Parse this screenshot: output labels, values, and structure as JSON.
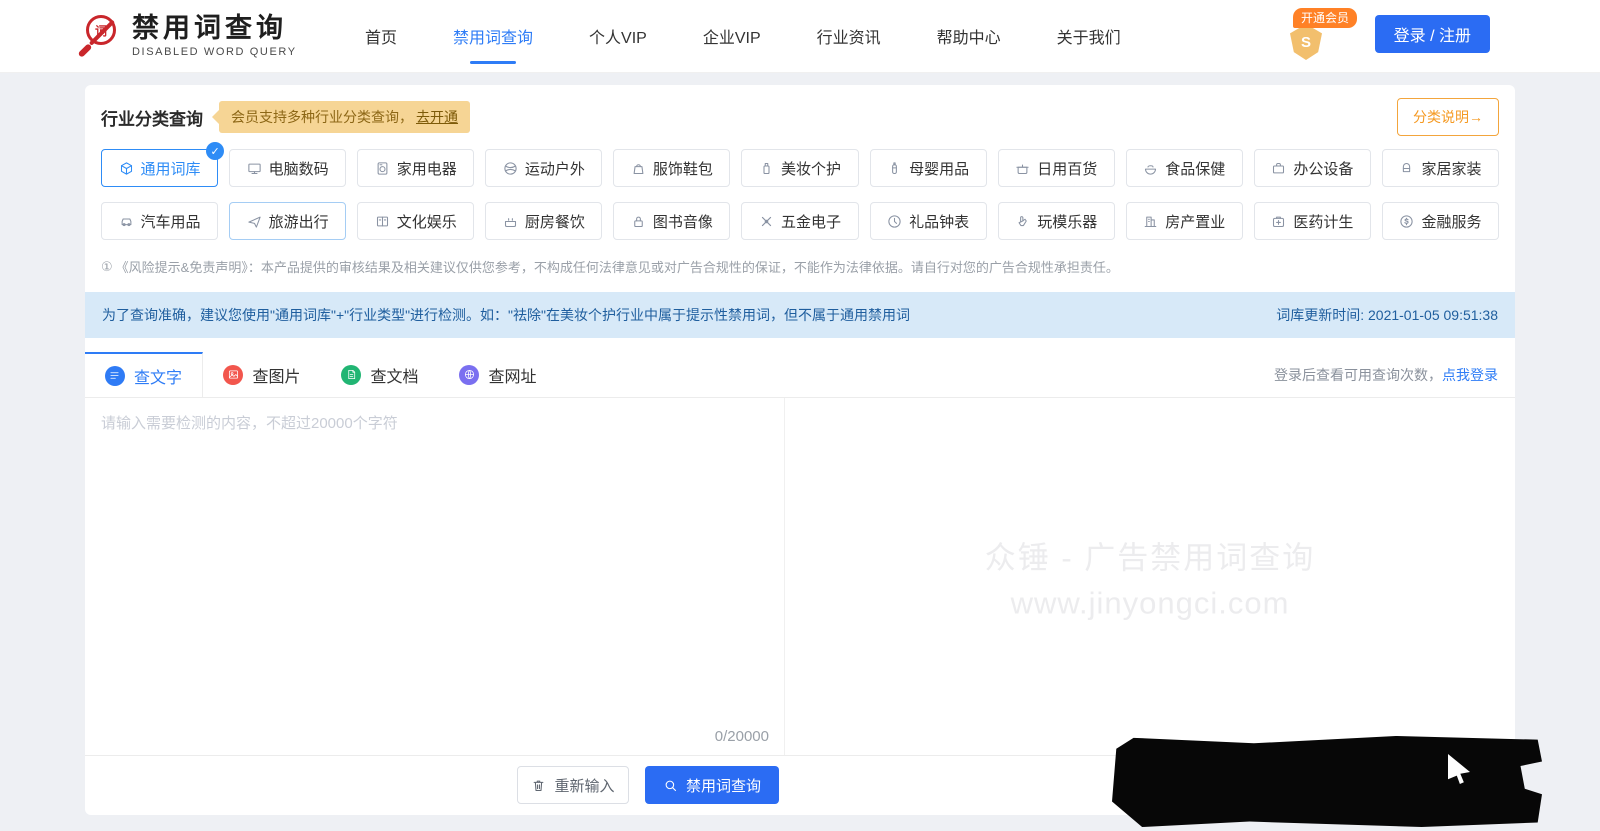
{
  "colors": {
    "accent_blue": "#2e7cf6",
    "button_blue": "#2b6cf3",
    "orange": "#ff8126",
    "tip_bg": "#f6d595",
    "notice_bg": "#d7e9f8",
    "logo_red": "#c9262b"
  },
  "header": {
    "logo": {
      "title": "禁用词查询",
      "subtitle": "DISABLED WORD QUERY",
      "icon_char": "词"
    },
    "nav": [
      {
        "label": "首页",
        "active": false
      },
      {
        "label": "禁用词查询",
        "active": true
      },
      {
        "label": "个人VIP",
        "active": false
      },
      {
        "label": "企业VIP",
        "active": false
      },
      {
        "label": "行业资讯",
        "active": false
      },
      {
        "label": "帮助中心",
        "active": false
      },
      {
        "label": "关于我们",
        "active": false
      }
    ],
    "member_badge": "开通会员",
    "member_shield_letter": "S",
    "login_label": "登录 / 注册"
  },
  "category": {
    "title": "行业分类查询",
    "member_tip": "会员支持多种行业分类查询，",
    "member_tip_link": "去开通",
    "explain_button": "分类说明→",
    "chips_row1": [
      {
        "label": "通用词库",
        "icon": "cube",
        "selected": true
      },
      {
        "label": "电脑数码",
        "icon": "monitor"
      },
      {
        "label": "家用电器",
        "icon": "washer"
      },
      {
        "label": "运动户外",
        "icon": "ball"
      },
      {
        "label": "服饰鞋包",
        "icon": "bag"
      },
      {
        "label": "美妆个护",
        "icon": "bottle"
      },
      {
        "label": "母婴用品",
        "icon": "feeder"
      },
      {
        "label": "日用百货",
        "icon": "pot"
      },
      {
        "label": "食品保健",
        "icon": "food"
      },
      {
        "label": "办公设备",
        "icon": "briefcase"
      },
      {
        "label": "家居家装",
        "icon": "furniture"
      }
    ],
    "chips_row2": [
      {
        "label": "汽车用品",
        "icon": "car"
      },
      {
        "label": "旅游出行",
        "icon": "plane",
        "hovered": true
      },
      {
        "label": "文化娱乐",
        "icon": "book"
      },
      {
        "label": "厨房餐饮",
        "icon": "cooking"
      },
      {
        "label": "图书音像",
        "icon": "media"
      },
      {
        "label": "五金电子",
        "icon": "tools"
      },
      {
        "label": "礼品钟表",
        "icon": "clock"
      },
      {
        "label": "玩模乐器",
        "icon": "hand"
      },
      {
        "label": "房产置业",
        "icon": "building"
      },
      {
        "label": "医药计生",
        "icon": "medkit"
      },
      {
        "label": "金融服务",
        "icon": "coin"
      }
    ],
    "disclaimer_icon": "①",
    "disclaimer": "《风险提示&免责声明》：本产品提供的审核结果及相关建议仅供您参考，不构成任何法律意见或对广告合规性的保证，不能作为法律依据。请自行对您的广告合规性承担责任。"
  },
  "notice": {
    "text": "为了查询准确，建议您使用\"通用词库\"+\"行业类型\"进行检测。如：\"祛除\"在美妆个护行业中属于提示性禁用词，但不属于通用禁用词",
    "update_time": "词库更新时间: 2021-01-05 09:51:38"
  },
  "query": {
    "tabs": [
      {
        "label": "查文字",
        "icon": "text",
        "color": "#2f7bf5",
        "active": true
      },
      {
        "label": "查图片",
        "icon": "image",
        "color": "#f2564d",
        "active": false
      },
      {
        "label": "查文档",
        "icon": "docfile",
        "color": "#21b573",
        "active": false
      },
      {
        "label": "查网址",
        "icon": "globe",
        "color": "#7a6ff0",
        "active": false
      }
    ],
    "login_hint": "登录后查看可用查询次数，",
    "login_link": "点我登录",
    "textarea_placeholder": "请输入需要检测的内容，不超过20000个字符",
    "textarea_value": "",
    "char_counter": "0/20000",
    "watermark_line1": "众锤 - 广告禁用词查询",
    "watermark_line2": "www.jinyongci.com",
    "reset_button": "重新输入",
    "search_button": "禁用词查询"
  }
}
